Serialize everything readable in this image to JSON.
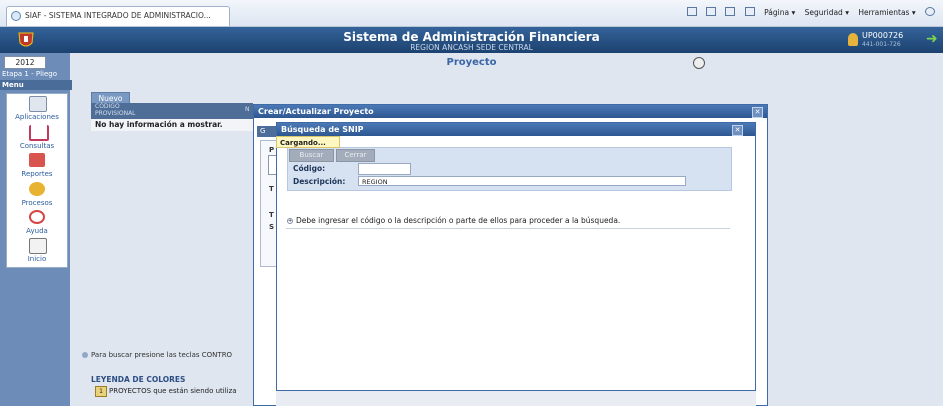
{
  "browser": {
    "tab_title": "SIAF - SISTEMA INTEGRADO DE ADMINISTRACIO...",
    "toolbar": [
      "Página ▾",
      "Seguridad ▾",
      "Herramientas ▾"
    ]
  },
  "header": {
    "title": "Sistema de Administración Financiera",
    "subtitle": "REGION ANCASH SEDE CENTRAL",
    "user_code": "UP000726",
    "user_sub": "441-001-726"
  },
  "sidebar": {
    "year": "2012",
    "etapa": "Etapa 1 - Pliego",
    "menu_label": "Menu",
    "items": [
      {
        "label": "Aplicaciones",
        "icon": "applications-icon"
      },
      {
        "label": "Consultas",
        "icon": "queries-icon"
      },
      {
        "label": "Reportes",
        "icon": "reports-icon"
      },
      {
        "label": "Procesos",
        "icon": "processes-icon"
      },
      {
        "label": "Ayuda",
        "icon": "help-icon"
      },
      {
        "label": "Inicio",
        "icon": "home-icon"
      }
    ]
  },
  "page": {
    "title": "Proyecto",
    "nuevo": "Nuevo",
    "col_codigo": "CÓDIGO",
    "col_provisional": "PROVISIONAL",
    "col_n": "N",
    "empty_msg": "No hay información a mostrar.",
    "hint": "Para buscar presione las teclas CONTRO",
    "legend_title": "LEYENDA DE COLORES",
    "legend_box": "1",
    "legend_text": "PROYECTOS que están siendo utiliza"
  },
  "dialog_outer": {
    "title": "Crear/Actualizar Proyecto",
    "tab": "G",
    "labels": [
      "P",
      "T",
      "T",
      "S"
    ]
  },
  "dialog_inner": {
    "title": "Búsqueda de SNIP",
    "loading": "Cargando...",
    "buscar": "Buscar",
    "cerrar": "Cerrar",
    "codigo_label": "Código:",
    "codigo_value": "",
    "descripcion_label": "Descripción:",
    "descripcion_value": "REGION",
    "info": "Debe ingresar el código o la descripción o parte de ellos para proceder a la búsqueda."
  }
}
